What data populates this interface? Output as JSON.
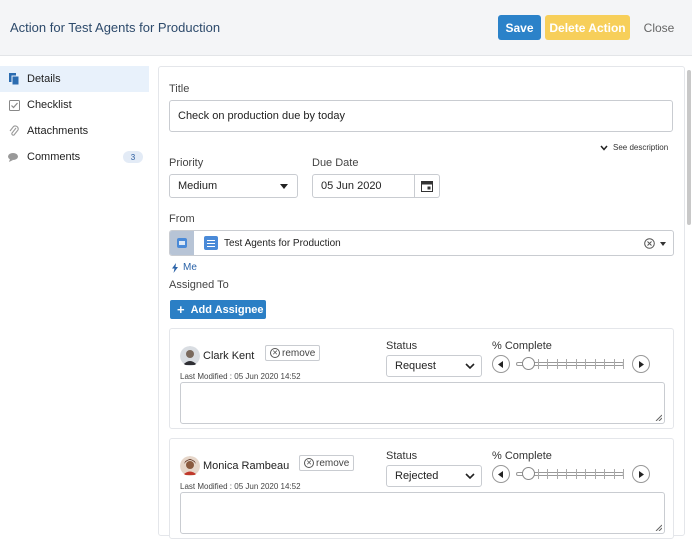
{
  "header": {
    "title": "Action for Test Agents for Production",
    "save_label": "Save",
    "delete_label": "Delete Action",
    "close_label": "Close"
  },
  "sidebar": {
    "items": [
      {
        "label": "Details",
        "icon": "details-icon",
        "active": true
      },
      {
        "label": "Checklist",
        "icon": "checklist-icon"
      },
      {
        "label": "Attachments",
        "icon": "paperclip-icon"
      },
      {
        "label": "Comments",
        "icon": "comments-icon",
        "count": "3"
      }
    ]
  },
  "form": {
    "title_label": "Title",
    "title_value": "Check on production due by today",
    "see_description": "See description",
    "priority_label": "Priority",
    "priority_value": "Medium",
    "due_date_label": "Due Date",
    "due_date_value": "05 Jun 2020",
    "from_label": "From",
    "from_value": "Test Agents for Production",
    "me_label": "Me",
    "assigned_to_label": "Assigned To",
    "add_assignee_label": "Add Assignee"
  },
  "assignees": [
    {
      "name": "Clark Kent",
      "remove_label": "remove",
      "modified": "Last Modified : 05 Jun 2020 14:52",
      "status_label": "Status",
      "status_value": "Request",
      "percent_label": "% Complete",
      "percent": 0
    },
    {
      "name": "Monica Rambeau",
      "remove_label": "remove",
      "modified": "Last Modified : 05 Jun 2020 14:52",
      "status_label": "Status",
      "status_value": "Rejected",
      "percent_label": "% Complete",
      "percent": 0
    }
  ],
  "colors": {
    "accent": "#2b82c9",
    "delete": "#f7cf5a",
    "link": "#2b63a8"
  }
}
